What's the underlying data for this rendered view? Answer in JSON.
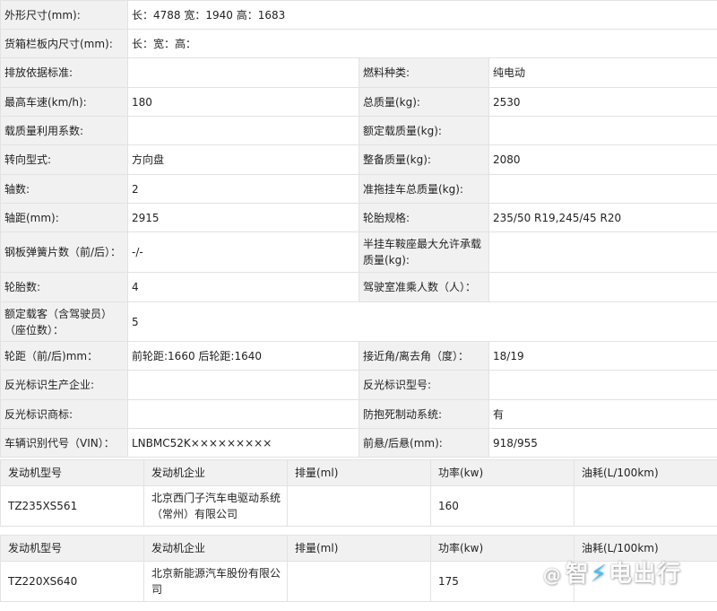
{
  "spec_rows": [
    {
      "l1": "外形尺寸(mm):",
      "v1": "长：4788 宽：1940 高：1683",
      "l2": "",
      "v2": ""
    },
    {
      "l1": "货箱栏板内尺寸(mm):",
      "v1": "长：宽：高：",
      "l2": "",
      "v2": ""
    },
    {
      "l1": "排放依据标准:",
      "v1": "",
      "l2": "燃料种类:",
      "v2": "纯电动"
    },
    {
      "l1": "最高车速(km/h):",
      "v1": "180",
      "l2": "总质量(kg):",
      "v2": "2530"
    },
    {
      "l1": "载质量利用系数:",
      "v1": "",
      "l2": "额定载质量(kg):",
      "v2": ""
    },
    {
      "l1": "转向型式:",
      "v1": "方向盘",
      "l2": "整备质量(kg):",
      "v2": "2080"
    },
    {
      "l1": "轴数:",
      "v1": "2",
      "l2": "准拖挂车总质量(kg):",
      "v2": ""
    },
    {
      "l1": "轴距(mm):",
      "v1": "2915",
      "l2": "轮胎规格:",
      "v2": "235/50 R19,245/45 R20"
    },
    {
      "l1": "钢板弹簧片数（前/后）：",
      "v1": "-/-",
      "l2": "半挂车鞍座最大允许承载质量(kg):",
      "v2": ""
    },
    {
      "l1": "轮胎数:",
      "v1": "4",
      "l2": "驾驶室准乘人数（人）：",
      "v2": ""
    },
    {
      "l1": "额定载客（含驾驶员）（座位数）：",
      "v1": "5",
      "l2": "",
      "v2": ""
    },
    {
      "l1": "轮距（前/后)mm：",
      "v1": "前轮距:1660 后轮距:1640",
      "l2": "接近角/离去角（度）：",
      "v2": "18/19"
    },
    {
      "l1": "反光标识生产企业:",
      "v1": "",
      "l2": "反光标识型号:",
      "v2": ""
    },
    {
      "l1": "反光标识商标:",
      "v1": "",
      "l2": "防抱死制动系统:",
      "v2": "有"
    },
    {
      "l1": "车辆识别代号（VIN）：",
      "v1": "LNBMC52K×××××××××",
      "l2": "前悬/后悬(mm):",
      "v2": "918/955"
    }
  ],
  "engine_headers": [
    "发动机型号",
    "发动机企业",
    "排量(ml)",
    "功率(kw)",
    "油耗(L/100km)"
  ],
  "engines": [
    {
      "model": "TZ235XS561",
      "company": "北京西门子汽车电驱动系统（常州）有限公司",
      "displacement": "",
      "power": "160",
      "fuel": ""
    },
    {
      "model": "TZ220XS640",
      "company": "北京新能源汽车股份有限公司",
      "displacement": "",
      "power": "175",
      "fuel": ""
    }
  ],
  "watermark": {
    "at": "@",
    "text_a": "智",
    "text_b": "电出行"
  }
}
